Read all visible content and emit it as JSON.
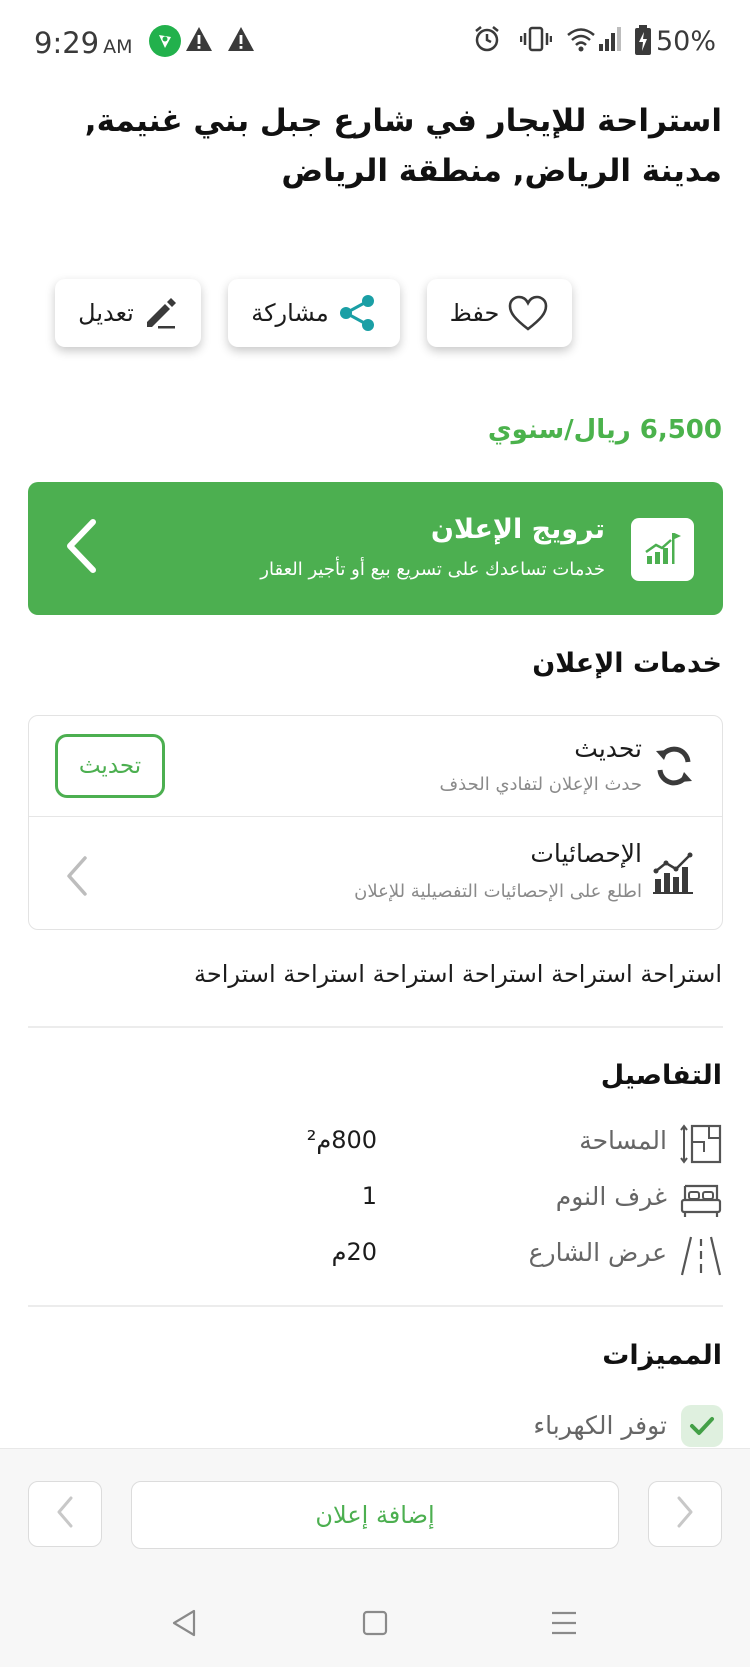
{
  "status_bar": {
    "time": "9:29",
    "ampm": "AM",
    "battery": "50%",
    "left_icons": [
      "location-badge-icon",
      "warning-icon",
      "warning-icon"
    ],
    "right_icons": [
      "alarm-icon",
      "vibrate-icon",
      "wifi-icon",
      "signal-icon",
      "battery-icon"
    ]
  },
  "listing": {
    "title": "استراحة للإيجار في شارع جبل بني غنيمة, مدينة الرياض, منطقة الرياض",
    "price": "6,500 ريال/سنوي",
    "description": "استراحة استراحة استراحة استراحة استراحة استراحة"
  },
  "actions": {
    "save": "حفظ",
    "share": "مشاركة",
    "edit": "تعديل"
  },
  "promo": {
    "title": "ترويج الإعلان",
    "subtitle": "خدمات تساعدك على تسريع بيع أو تأجير العقار"
  },
  "services": {
    "heading": "خدمات الإعلان",
    "refresh": {
      "title": "تحديث",
      "subtitle": "حدث الإعلان لتفادي الحذف",
      "button": "تحديث"
    },
    "stats": {
      "title": "الإحصائيات",
      "subtitle": "اطلع على الإحصائيات التفصيلية للإعلان"
    }
  },
  "details": {
    "heading": "التفاصيل",
    "rows": [
      {
        "icon": "area-icon",
        "label": "المساحة",
        "value": "800م²"
      },
      {
        "icon": "bed-icon",
        "label": "غرف النوم",
        "value": "1"
      },
      {
        "icon": "road-icon",
        "label": "عرض الشارع",
        "value": "20م"
      }
    ]
  },
  "features": {
    "heading": "المميزات",
    "items": [
      {
        "icon": "check-icon",
        "label": "توفر الكهرباء"
      }
    ]
  },
  "bottom": {
    "add_listing": "إضافة إعلان"
  },
  "colors": {
    "accent": "#4caf50",
    "price": "#4bb24c",
    "share_icon": "#1a9fa5"
  }
}
